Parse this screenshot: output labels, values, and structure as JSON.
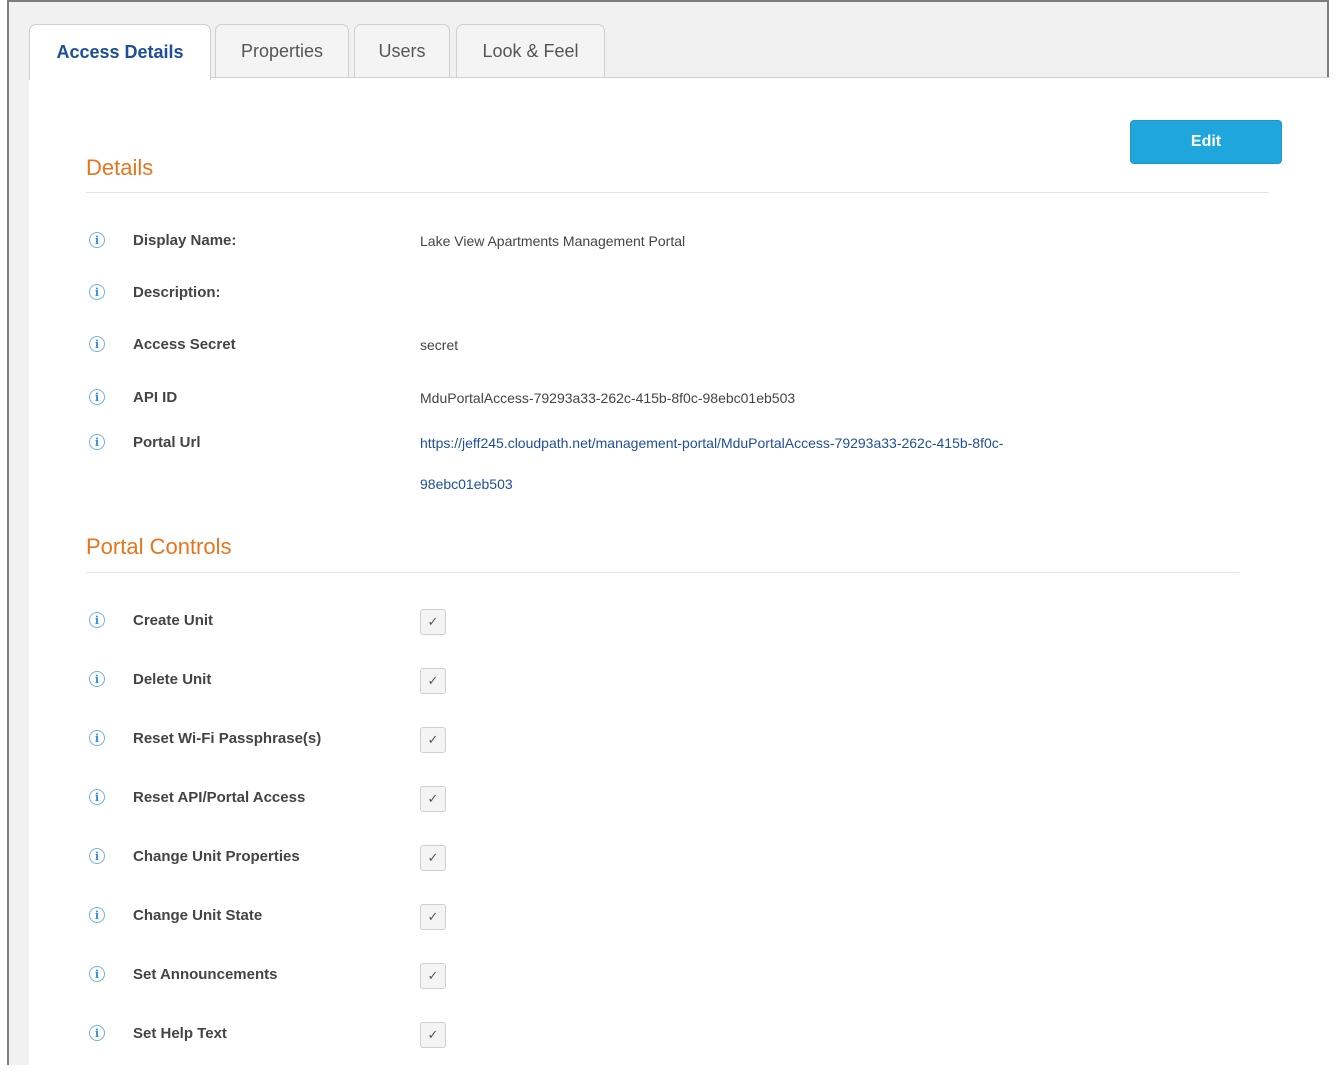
{
  "tabs": [
    {
      "label": "Access Details",
      "active": true
    },
    {
      "label": "Properties",
      "active": false
    },
    {
      "label": "Users",
      "active": false
    },
    {
      "label": "Look & Feel",
      "active": false
    }
  ],
  "edit_label": "Edit",
  "details": {
    "title": "Details",
    "fields": [
      {
        "label": "Display Name:",
        "value": "Lake View Apartments Management Portal"
      },
      {
        "label": "Description:",
        "value": ""
      },
      {
        "label": "Access Secret",
        "value": "secret"
      },
      {
        "label": "API ID",
        "value": "MduPortalAccess-79293a33-262c-415b-8f0c-98ebc01eb503"
      },
      {
        "label": "Portal Url",
        "value_line1": "https://jeff245.cloudpath.net/management-portal/MduPortalAccess-79293a33-262c-415b-8f0c-",
        "value_line2": "98ebc01eb503"
      }
    ]
  },
  "portal_controls": {
    "title": "Portal Controls",
    "items": [
      {
        "label": "Create Unit",
        "checked": true
      },
      {
        "label": "Delete Unit",
        "checked": true
      },
      {
        "label": "Reset Wi-Fi Passphrase(s)",
        "checked": true
      },
      {
        "label": "Reset API/Portal Access",
        "checked": true
      },
      {
        "label": "Change Unit Properties",
        "checked": true
      },
      {
        "label": "Change Unit State",
        "checked": true
      },
      {
        "label": "Set Announcements",
        "checked": true
      },
      {
        "label": "Set Help Text",
        "checked": true
      }
    ]
  },
  "glyphs": {
    "info": "i",
    "check": "✓"
  },
  "colors": {
    "accent_title": "#e8741c",
    "edit_button": "#1ea6dd",
    "link": "#1f4f9c",
    "active_tab_text": "#1d4e9b"
  }
}
